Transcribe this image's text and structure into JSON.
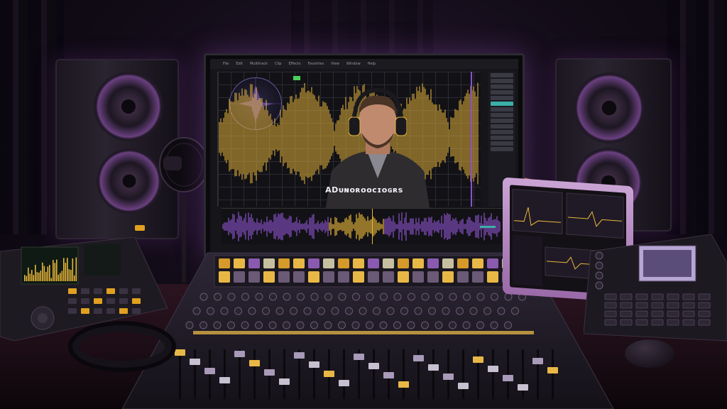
{
  "app": {
    "menu": [
      "File",
      "Edit",
      "Multitrack",
      "Clip",
      "Effects",
      "Favorites",
      "View",
      "Window",
      "Help"
    ],
    "caption": "ADᴜɴoʀoocɪᴏɢʀs",
    "caption_plain": "ADUɴoROCIOGRS"
  },
  "side_panel": {
    "rows": 14,
    "highlight_index": 5
  },
  "colors": {
    "waveform_gold": "#e9b73a",
    "waveform_purple": "#8a52c9",
    "accent_teal": "#3bb0a8",
    "accent_green": "#4ad05a",
    "ambient_magenta": "#c04cb0"
  },
  "icons": [
    "polar-pattern-icon",
    "play-icon",
    "record-icon",
    "fader-icon",
    "knob-icon",
    "mouse-icon"
  ]
}
